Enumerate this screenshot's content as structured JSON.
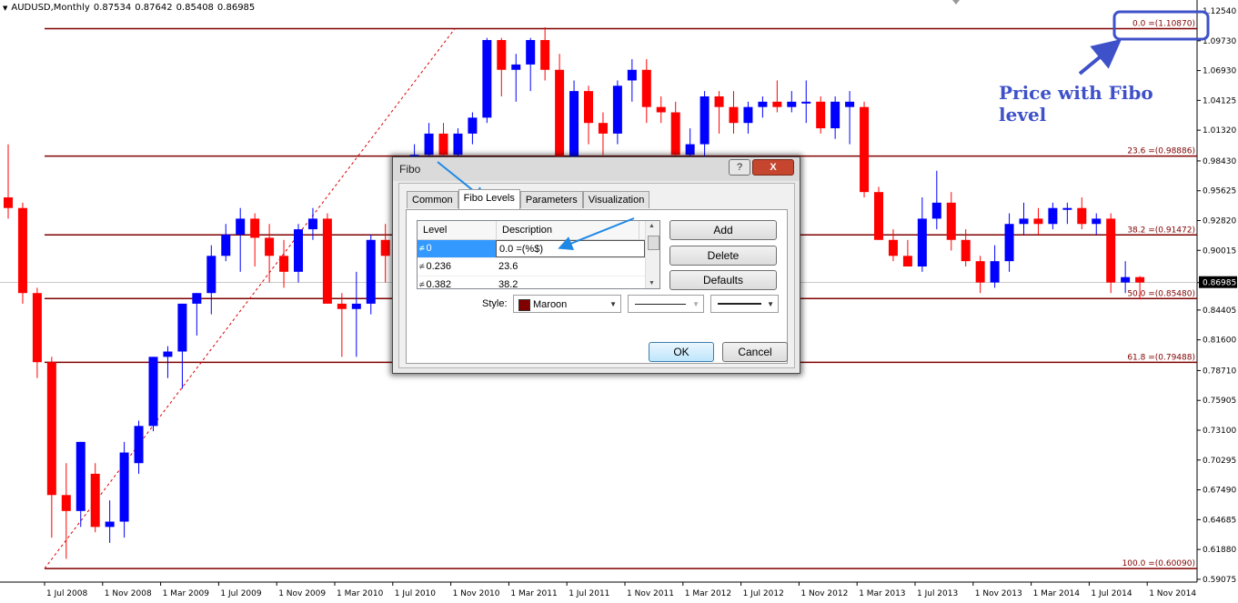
{
  "chart_data": {
    "type": "candlestick",
    "symbol": "AUDUSD,Monthly",
    "ohlc": [
      "0.87534",
      "0.87642",
      "0.85408",
      "0.86985"
    ],
    "current_price": "0.86985",
    "y_ticks": [
      "1.12540",
      "1.09730",
      "1.06930",
      "1.04125",
      "1.01320",
      "0.98430",
      "0.95625",
      "0.92820",
      "0.90015",
      "0.86985",
      "0.84405",
      "0.81600",
      "0.78710",
      "0.75905",
      "0.73100",
      "0.70295",
      "0.67490",
      "0.64685",
      "0.61880",
      "0.59075"
    ],
    "x_ticks": [
      "1 Jul 2008",
      "1 Nov 2008",
      "1 Mar 2009",
      "1 Jul 2009",
      "1 Nov 2009",
      "1 Mar 2010",
      "1 Jul 2010",
      "1 Nov 2010",
      "1 Mar 2011",
      "1 Jul 2011",
      "1 Nov 2011",
      "1 Mar 2012",
      "1 Jul 2012",
      "1 Nov 2012",
      "1 Mar 2013",
      "1 Jul 2013",
      "1 Nov 2013",
      "1 Mar 2014",
      "1 Jul 2014",
      "1 Nov 2014"
    ],
    "ylim": [
      0.5907,
      1.1254
    ],
    "fibo_levels": [
      {
        "level": "0.0",
        "price": 1.1087,
        "label": "0.0 =(1.10870)"
      },
      {
        "level": "23.6",
        "price": 0.98886,
        "label": "23.6 =(0.98886)"
      },
      {
        "level": "38.2",
        "price": 0.91472,
        "label": "38.2 =(0.91472)"
      },
      {
        "level": "50.0",
        "price": 0.8548,
        "label": "50.0 =(0.85480)"
      },
      {
        "level": "61.8",
        "price": 0.79488,
        "label": "61.8 =(0.79488)"
      },
      {
        "level": "100.0",
        "price": 0.6009,
        "label": "100.0 =(0.60090)"
      }
    ],
    "bull_color": "#0000ff",
    "bear_color": "#ff0000",
    "fibo_color": "#800000",
    "candles": [
      {
        "o": 0.95,
        "h": 1.0,
        "l": 0.93,
        "c": 0.94
      },
      {
        "o": 0.94,
        "h": 0.945,
        "l": 0.85,
        "c": 0.86
      },
      {
        "o": 0.86,
        "h": 0.865,
        "l": 0.78,
        "c": 0.795
      },
      {
        "o": 0.795,
        "h": 0.8,
        "l": 0.63,
        "c": 0.67
      },
      {
        "o": 0.67,
        "h": 0.7,
        "l": 0.61,
        "c": 0.655
      },
      {
        "o": 0.655,
        "h": 0.72,
        "l": 0.64,
        "c": 0.72
      },
      {
        "o": 0.69,
        "h": 0.7,
        "l": 0.635,
        "c": 0.64
      },
      {
        "o": 0.64,
        "h": 0.665,
        "l": 0.625,
        "c": 0.645
      },
      {
        "o": 0.645,
        "h": 0.72,
        "l": 0.63,
        "c": 0.71
      },
      {
        "o": 0.7,
        "h": 0.74,
        "l": 0.69,
        "c": 0.735
      },
      {
        "o": 0.735,
        "h": 0.8,
        "l": 0.73,
        "c": 0.8
      },
      {
        "o": 0.8,
        "h": 0.81,
        "l": 0.78,
        "c": 0.805
      },
      {
        "o": 0.805,
        "h": 0.85,
        "l": 0.77,
        "c": 0.85
      },
      {
        "o": 0.85,
        "h": 0.86,
        "l": 0.82,
        "c": 0.86
      },
      {
        "o": 0.86,
        "h": 0.905,
        "l": 0.84,
        "c": 0.895
      },
      {
        "o": 0.895,
        "h": 0.925,
        "l": 0.89,
        "c": 0.915
      },
      {
        "o": 0.915,
        "h": 0.94,
        "l": 0.88,
        "c": 0.93
      },
      {
        "o": 0.93,
        "h": 0.935,
        "l": 0.885,
        "c": 0.912
      },
      {
        "o": 0.912,
        "h": 0.925,
        "l": 0.87,
        "c": 0.895
      },
      {
        "o": 0.895,
        "h": 0.91,
        "l": 0.865,
        "c": 0.88
      },
      {
        "o": 0.88,
        "h": 0.925,
        "l": 0.87,
        "c": 0.92
      },
      {
        "o": 0.92,
        "h": 0.94,
        "l": 0.91,
        "c": 0.93
      },
      {
        "o": 0.93,
        "h": 0.935,
        "l": 0.85,
        "c": 0.85
      },
      {
        "o": 0.85,
        "h": 0.86,
        "l": 0.8,
        "c": 0.845
      },
      {
        "o": 0.845,
        "h": 0.88,
        "l": 0.8,
        "c": 0.85
      },
      {
        "o": 0.85,
        "h": 0.915,
        "l": 0.84,
        "c": 0.91
      },
      {
        "o": 0.91,
        "h": 0.925,
        "l": 0.87,
        "c": 0.895
      },
      {
        "o": 0.895,
        "h": 0.975,
        "l": 0.89,
        "c": 0.97
      },
      {
        "o": 0.97,
        "h": 1.0,
        "l": 0.96,
        "c": 0.99
      },
      {
        "o": 0.99,
        "h": 1.02,
        "l": 0.96,
        "c": 1.01
      },
      {
        "o": 1.01,
        "h": 1.02,
        "l": 0.98,
        "c": 0.99
      },
      {
        "o": 0.99,
        "h": 1.015,
        "l": 0.98,
        "c": 1.01
      },
      {
        "o": 1.01,
        "h": 1.03,
        "l": 1.0,
        "c": 1.025
      },
      {
        "o": 1.025,
        "h": 1.1,
        "l": 1.02,
        "c": 1.098
      },
      {
        "o": 1.098,
        "h": 1.1,
        "l": 1.045,
        "c": 1.07
      },
      {
        "o": 1.07,
        "h": 1.085,
        "l": 1.04,
        "c": 1.075
      },
      {
        "o": 1.075,
        "h": 1.1,
        "l": 1.05,
        "c": 1.098
      },
      {
        "o": 1.098,
        "h": 1.11,
        "l": 1.06,
        "c": 1.07
      },
      {
        "o": 1.07,
        "h": 1.085,
        "l": 0.94,
        "c": 0.96
      },
      {
        "o": 0.96,
        "h": 1.06,
        "l": 0.94,
        "c": 1.05
      },
      {
        "o": 1.05,
        "h": 1.055,
        "l": 1.0,
        "c": 1.02
      },
      {
        "o": 1.02,
        "h": 1.03,
        "l": 0.99,
        "c": 1.01
      },
      {
        "o": 1.01,
        "h": 1.06,
        "l": 1.0,
        "c": 1.055
      },
      {
        "o": 1.06,
        "h": 1.08,
        "l": 1.04,
        "c": 1.07
      },
      {
        "o": 1.07,
        "h": 1.08,
        "l": 1.02,
        "c": 1.035
      },
      {
        "o": 1.035,
        "h": 1.045,
        "l": 1.02,
        "c": 1.03
      },
      {
        "o": 1.03,
        "h": 1.04,
        "l": 0.96,
        "c": 0.99
      },
      {
        "o": 0.99,
        "h": 1.015,
        "l": 0.95,
        "c": 1.0
      },
      {
        "o": 1.0,
        "h": 1.05,
        "l": 0.98,
        "c": 1.045
      },
      {
        "o": 1.045,
        "h": 1.05,
        "l": 1.01,
        "c": 1.035
      },
      {
        "o": 1.035,
        "h": 1.05,
        "l": 1.01,
        "c": 1.02
      },
      {
        "o": 1.02,
        "h": 1.04,
        "l": 1.01,
        "c": 1.035
      },
      {
        "o": 1.035,
        "h": 1.045,
        "l": 1.025,
        "c": 1.04
      },
      {
        "o": 1.04,
        "h": 1.06,
        "l": 1.03,
        "c": 1.035
      },
      {
        "o": 1.035,
        "h": 1.05,
        "l": 1.03,
        "c": 1.04
      },
      {
        "o": 1.04,
        "h": 1.06,
        "l": 1.02,
        "c": 1.04
      },
      {
        "o": 1.04,
        "h": 1.045,
        "l": 1.01,
        "c": 1.015
      },
      {
        "o": 1.015,
        "h": 1.045,
        "l": 1.005,
        "c": 1.04
      },
      {
        "o": 1.035,
        "h": 1.05,
        "l": 1.0,
        "c": 1.04
      },
      {
        "o": 1.035,
        "h": 1.04,
        "l": 0.95,
        "c": 0.955
      },
      {
        "o": 0.955,
        "h": 0.96,
        "l": 0.91,
        "c": 0.91
      },
      {
        "o": 0.91,
        "h": 0.92,
        "l": 0.89,
        "c": 0.895
      },
      {
        "o": 0.895,
        "h": 0.91,
        "l": 0.885,
        "c": 0.885
      },
      {
        "o": 0.885,
        "h": 0.95,
        "l": 0.88,
        "c": 0.93
      },
      {
        "o": 0.93,
        "h": 0.975,
        "l": 0.92,
        "c": 0.945
      },
      {
        "o": 0.945,
        "h": 0.955,
        "l": 0.9,
        "c": 0.91
      },
      {
        "o": 0.91,
        "h": 0.92,
        "l": 0.885,
        "c": 0.89
      },
      {
        "o": 0.89,
        "h": 0.895,
        "l": 0.86,
        "c": 0.87
      },
      {
        "o": 0.87,
        "h": 0.905,
        "l": 0.865,
        "c": 0.89
      },
      {
        "o": 0.89,
        "h": 0.935,
        "l": 0.88,
        "c": 0.925
      },
      {
        "o": 0.925,
        "h": 0.945,
        "l": 0.915,
        "c": 0.93
      },
      {
        "o": 0.93,
        "h": 0.94,
        "l": 0.915,
        "c": 0.925
      },
      {
        "o": 0.925,
        "h": 0.945,
        "l": 0.92,
        "c": 0.94
      },
      {
        "o": 0.94,
        "h": 0.945,
        "l": 0.925,
        "c": 0.94
      },
      {
        "o": 0.94,
        "h": 0.95,
        "l": 0.92,
        "c": 0.925
      },
      {
        "o": 0.925,
        "h": 0.935,
        "l": 0.915,
        "c": 0.93
      },
      {
        "o": 0.93,
        "h": 0.935,
        "l": 0.86,
        "c": 0.87
      },
      {
        "o": 0.87,
        "h": 0.89,
        "l": 0.86,
        "c": 0.875
      },
      {
        "o": 0.875,
        "h": 0.876,
        "l": 0.854,
        "c": 0.87
      }
    ]
  },
  "annotation": {
    "callout_text": "Price with Fibo level"
  },
  "dialog": {
    "title": "Fibo",
    "help_glyph": "?",
    "close_glyph": "X",
    "tabs": [
      "Common",
      "Fibo Levels",
      "Parameters",
      "Visualization"
    ],
    "active_tab": "Fibo Levels",
    "grid_headers": {
      "level": "Level",
      "description": "Description"
    },
    "rows": [
      {
        "level": "0",
        "description": "0.0 =(%$)",
        "selected": true
      },
      {
        "level": "0.236",
        "description": "23.6",
        "selected": false
      },
      {
        "level": "0.382",
        "description": "38.2",
        "selected": false
      }
    ],
    "buttons": {
      "add": "Add",
      "delete": "Delete",
      "defaults": "Defaults",
      "ok": "OK",
      "cancel": "Cancel"
    },
    "style_label": "Style:",
    "style_color_name": "Maroon",
    "style_color_hex": "#800000"
  }
}
